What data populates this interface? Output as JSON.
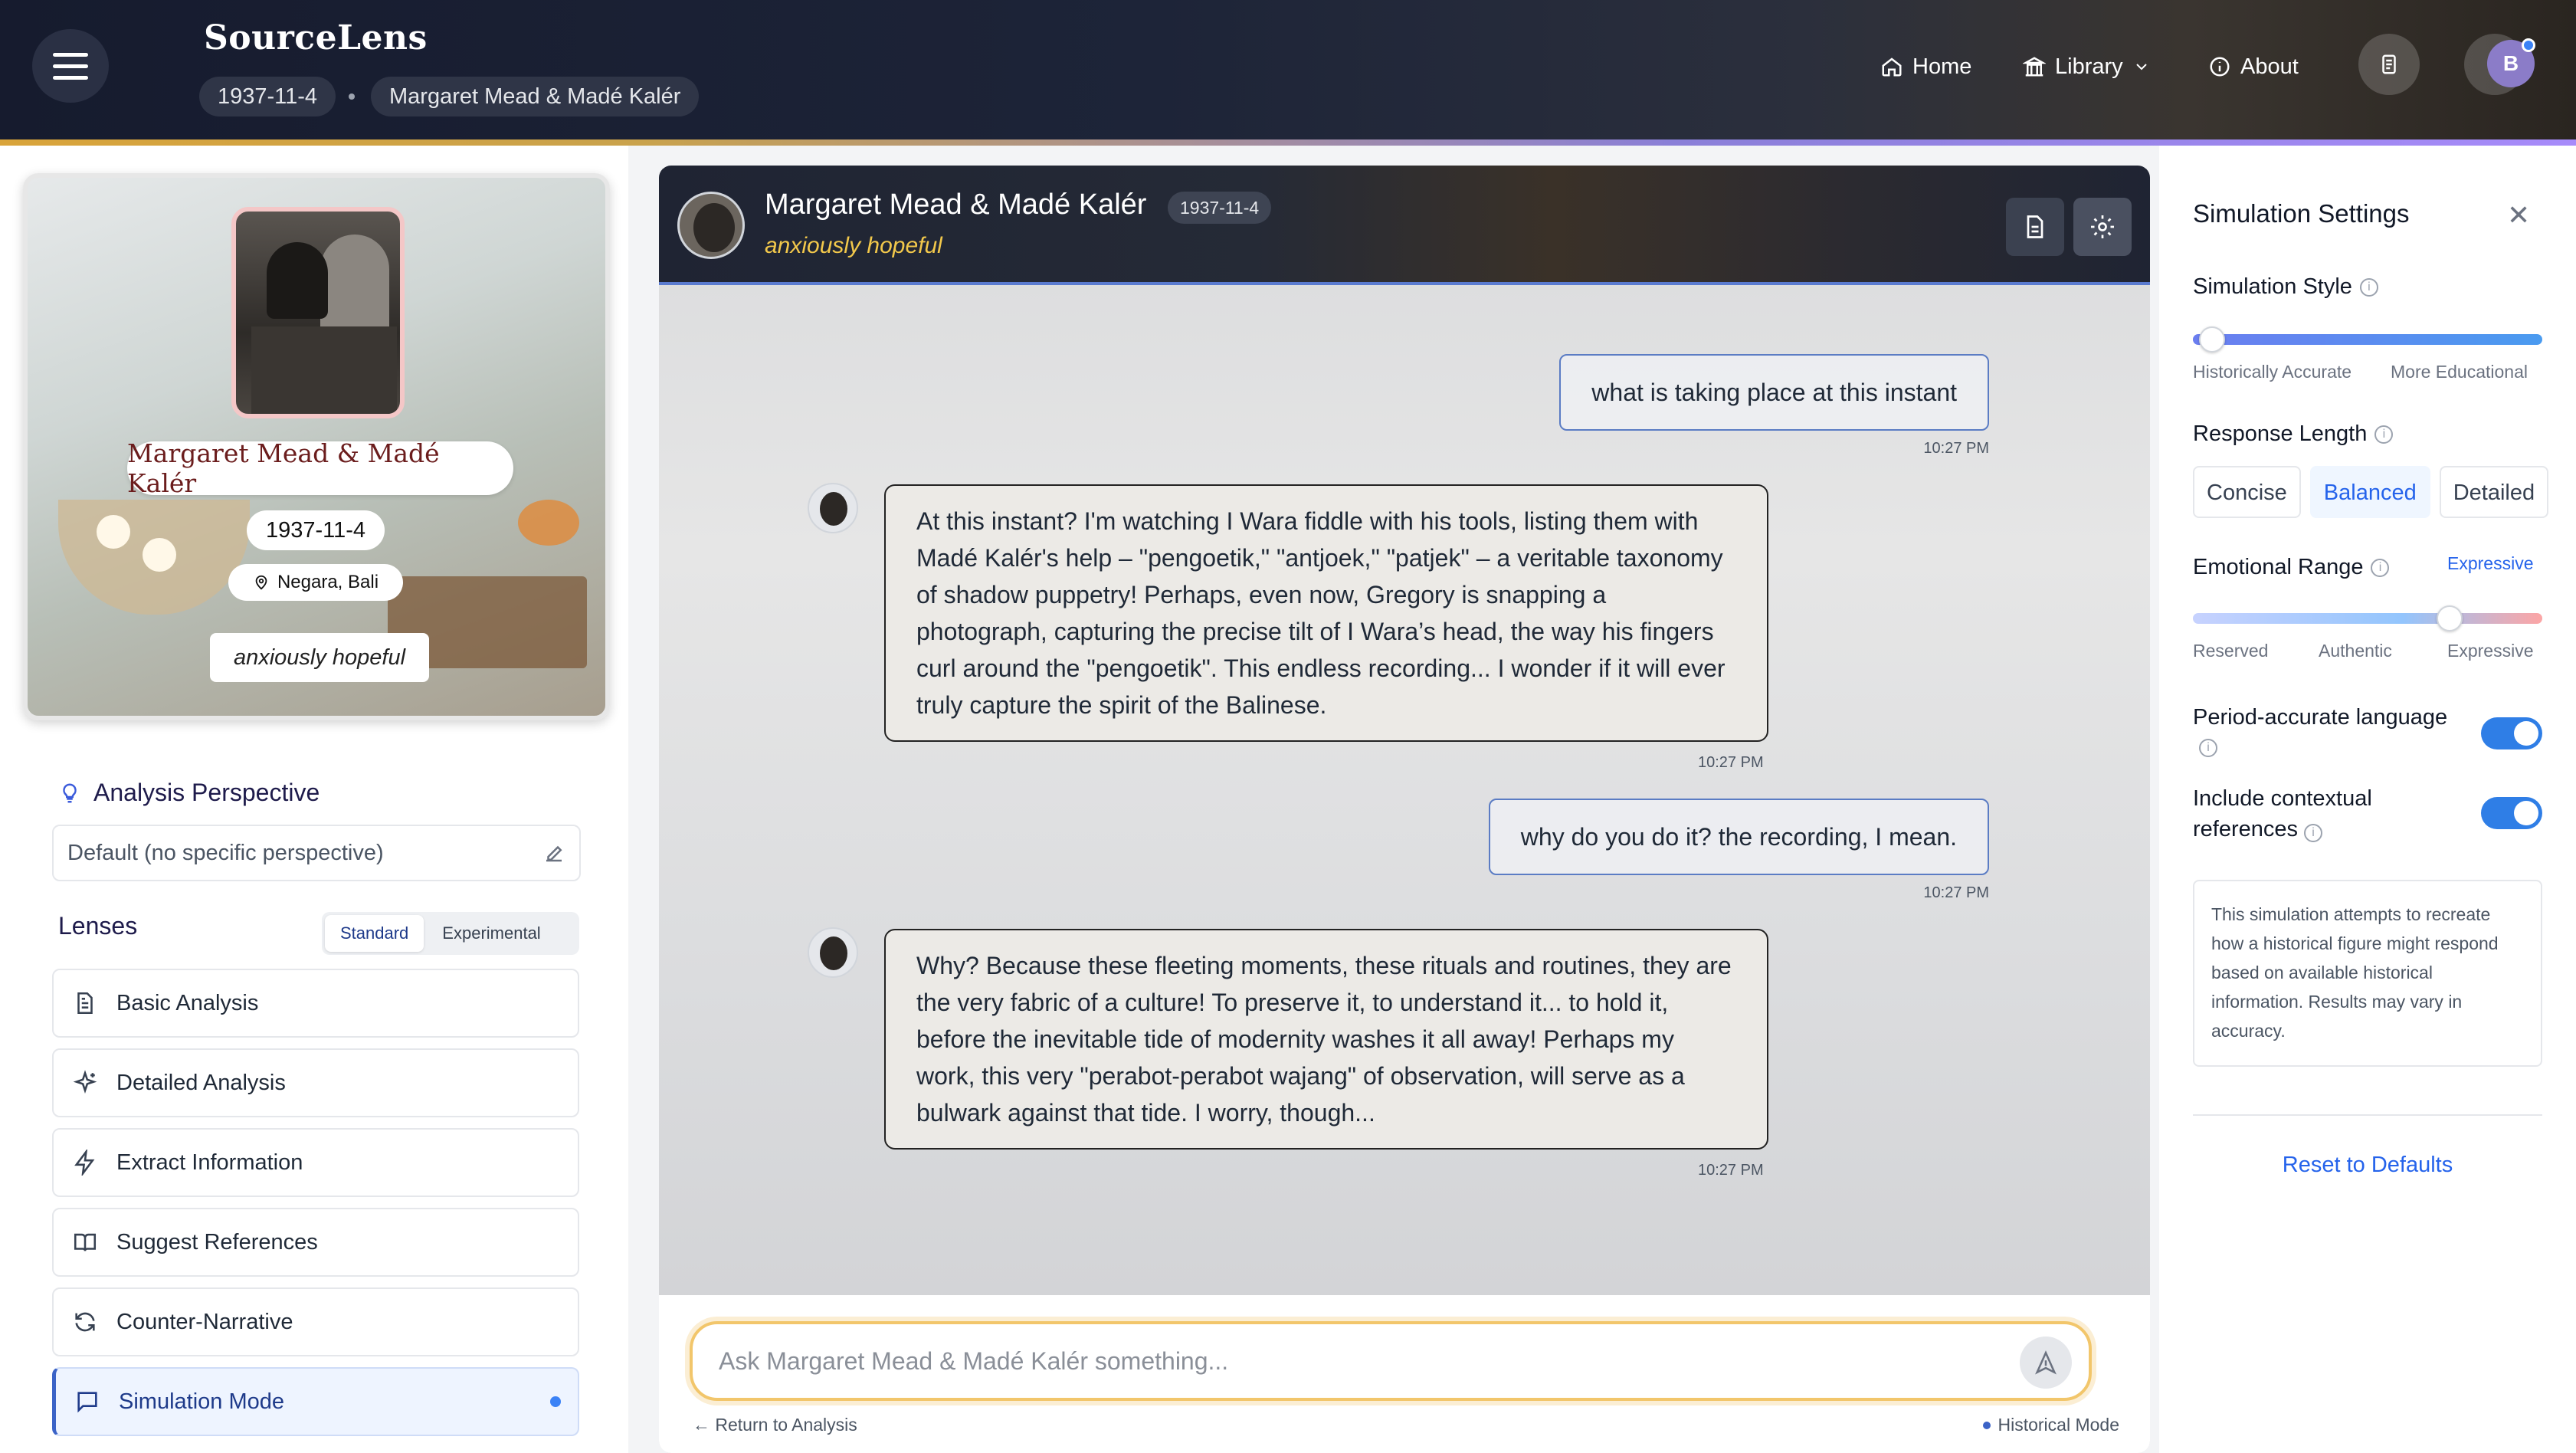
{
  "app": {
    "brand": "SourceLens"
  },
  "breadcrumb": {
    "date": "1937-11-4",
    "subject": "Margaret Mead & Madé Kalér"
  },
  "nav": {
    "home": "Home",
    "library": "Library",
    "about": "About",
    "avatar_initial": "B"
  },
  "profile": {
    "name": "Margaret Mead & Madé Kalér",
    "date": "1937-11-4",
    "location": "Negara, Bali",
    "mood": "anxiously hopeful"
  },
  "perspective": {
    "title": "Analysis Perspective",
    "value": "Default (no specific perspective)"
  },
  "lenses": {
    "title": "Lenses",
    "toggle": [
      "Standard",
      "Experimental"
    ],
    "items": [
      {
        "label": "Basic Analysis",
        "icon": "document-icon"
      },
      {
        "label": "Detailed Analysis",
        "icon": "sparkle-icon"
      },
      {
        "label": "Extract Information",
        "icon": "bolt-icon"
      },
      {
        "label": "Suggest References",
        "icon": "book-icon"
      },
      {
        "label": "Counter-Narrative",
        "icon": "refresh-icon"
      },
      {
        "label": "Simulation Mode",
        "icon": "chat-icon",
        "active": true
      }
    ]
  },
  "chat": {
    "name": "Margaret Mead & Madé Kalér",
    "date": "1937-11-4",
    "mood": "anxiously hopeful",
    "messages": [
      {
        "role": "user",
        "text": "what is taking place at this instant",
        "time": "10:27 PM"
      },
      {
        "role": "bot",
        "text": "At this instant? I'm watching I Wara fiddle with his tools, listing them with Madé Kalér's help – \"pengoetik,\" \"antjoek,\" \"patjek\" – a veritable taxonomy of shadow puppetry! Perhaps, even now, Gregory is snapping a photograph, capturing the precise tilt of I Wara’s head, the way his fingers curl around the \"pengoetik\". This endless recording... I wonder if it will ever truly capture the spirit of the Balinese.",
        "time": "10:27 PM"
      },
      {
        "role": "user",
        "text": "why do you do it? the recording, I mean.",
        "time": "10:27 PM"
      },
      {
        "role": "bot",
        "text": "Why? Because these fleeting moments, these rituals and routines, they are the very fabric of a culture! To preserve it, to understand it... to hold it, before the inevitable tide of modernity washes it all away! Perhaps my work, this very \"perabot-perabot wajang\" of observation, will serve as a bulwark against that tide. I worry, though...",
        "time": "10:27 PM"
      }
    ],
    "input_placeholder": "Ask Margaret Mead & Madé Kalér something...",
    "return_label": "Return to Analysis",
    "mode_label": "Historical Mode"
  },
  "settings": {
    "title": "Simulation Settings",
    "style": {
      "label": "Simulation Style",
      "min_label": "Historically Accurate",
      "max_label": "More Educational",
      "value": 0.04
    },
    "length": {
      "label": "Response Length",
      "options": [
        "Concise",
        "Balanced",
        "Detailed"
      ],
      "selected": "Balanced"
    },
    "emotion": {
      "label": "Emotional Range",
      "value_label": "Expressive",
      "scale": [
        "Reserved",
        "Authentic",
        "Expressive"
      ],
      "value": 0.7
    },
    "period_language": {
      "label": "Period-accurate language",
      "on": true
    },
    "context_refs": {
      "label": "Include contextual references",
      "on": true
    },
    "note": "This simulation attempts to recreate how a historical figure might respond based on available historical information. Results may vary in accuracy.",
    "reset": "Reset to Defaults"
  }
}
